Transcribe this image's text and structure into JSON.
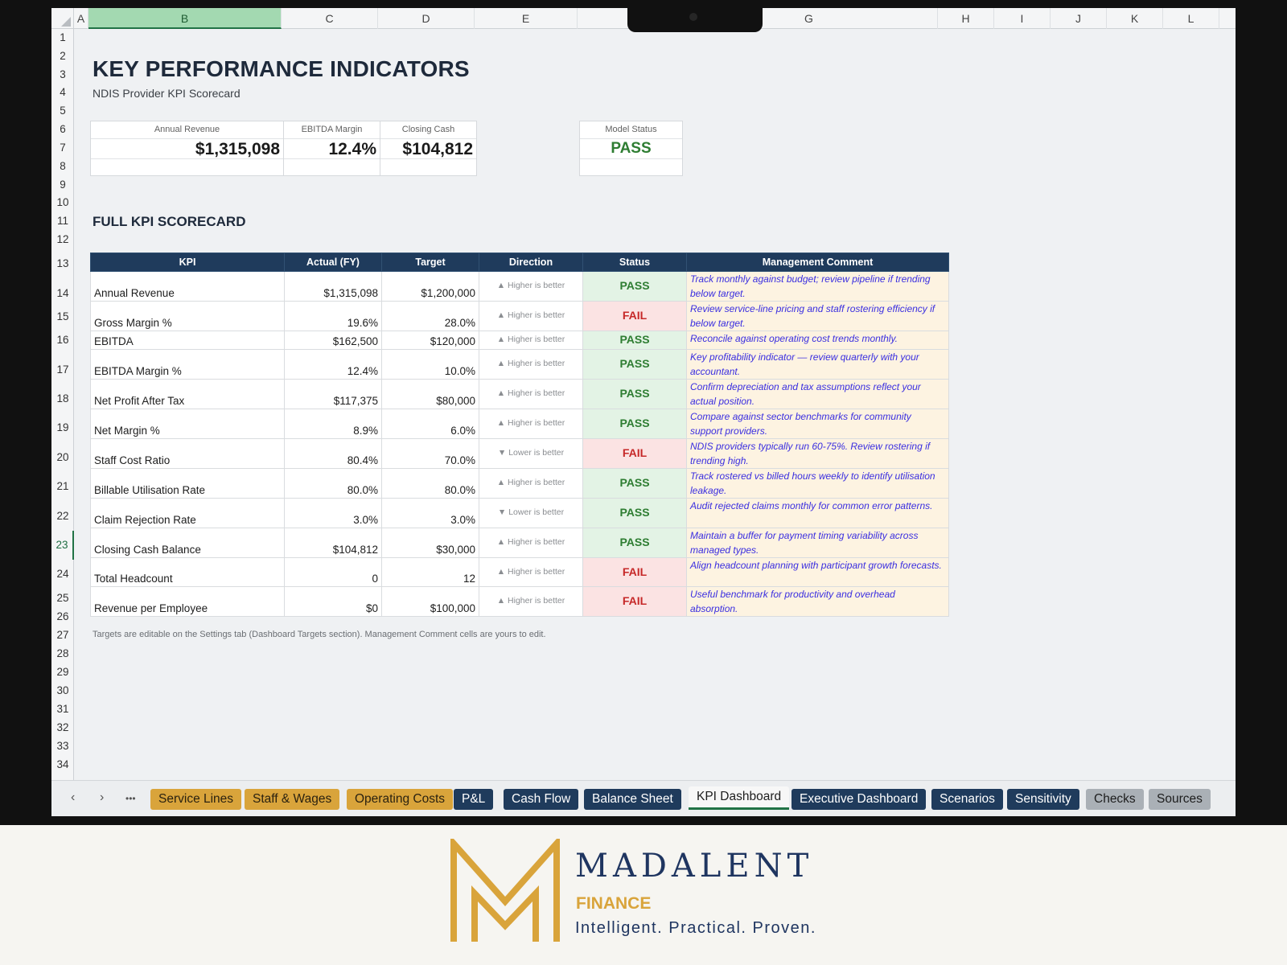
{
  "columns": [
    "A",
    "B",
    "C",
    "D",
    "E",
    "G",
    "H",
    "I",
    "J",
    "K",
    "L"
  ],
  "selected_column": "B",
  "rows": [
    "1",
    "2",
    "3",
    "4",
    "5",
    "6",
    "7",
    "8",
    "9",
    "10",
    "11",
    "12",
    "13",
    "14",
    "15",
    "16",
    "17",
    "18",
    "19",
    "20",
    "21",
    "22",
    "23",
    "24",
    "25",
    "26",
    "27",
    "28",
    "29",
    "30",
    "31",
    "32",
    "33",
    "34"
  ],
  "selected_row": "23",
  "page": {
    "title": "KEY PERFORMANCE INDICATORS",
    "subtitle": "NDIS Provider KPI Scorecard",
    "section": "FULL KPI SCORECARD",
    "footnote": "Targets are editable on the Settings tab (Dashboard Targets section). Management Comment cells are yours to edit."
  },
  "cards": {
    "revenue": {
      "label": "Annual Revenue",
      "value": "$1,315,098"
    },
    "ebitda": {
      "label": "EBITDA Margin",
      "value": "12.4%"
    },
    "cash": {
      "label": "Closing Cash",
      "value": "$104,812"
    },
    "status": {
      "label": "Model Status",
      "value": "PASS"
    }
  },
  "table": {
    "headers": [
      "KPI",
      "Actual (FY)",
      "Target",
      "Direction",
      "Status",
      "Management Comment"
    ],
    "rows": [
      {
        "kpi": "Annual Revenue",
        "actual": "$1,315,098",
        "target": "$1,200,000",
        "direction": "▲ Higher is better",
        "status": "PASS",
        "comment": "Track monthly against budget; review pipeline if trending below target."
      },
      {
        "kpi": "Gross Margin %",
        "actual": "19.6%",
        "target": "28.0%",
        "direction": "▲ Higher is better",
        "status": "FAIL",
        "comment": "Review service-line pricing and staff rostering efficiency if below target."
      },
      {
        "kpi": "EBITDA",
        "actual": "$162,500",
        "target": "$120,000",
        "direction": "▲ Higher is better",
        "status": "PASS",
        "comment": "Reconcile against operating cost trends monthly."
      },
      {
        "kpi": "EBITDA Margin %",
        "actual": "12.4%",
        "target": "10.0%",
        "direction": "▲ Higher is better",
        "status": "PASS",
        "comment": "Key profitability indicator — review quarterly with your accountant."
      },
      {
        "kpi": "Net Profit After Tax",
        "actual": "$117,375",
        "target": "$80,000",
        "direction": "▲ Higher is better",
        "status": "PASS",
        "comment": "Confirm depreciation and tax assumptions reflect your actual position."
      },
      {
        "kpi": "Net Margin %",
        "actual": "8.9%",
        "target": "6.0%",
        "direction": "▲ Higher is better",
        "status": "PASS",
        "comment": "Compare against sector benchmarks for community support providers."
      },
      {
        "kpi": "Staff Cost Ratio",
        "actual": "80.4%",
        "target": "70.0%",
        "direction": "▼ Lower is better",
        "status": "FAIL",
        "comment": "NDIS providers typically run 60-75%. Review rostering if trending high."
      },
      {
        "kpi": "Billable Utilisation Rate",
        "actual": "80.0%",
        "target": "80.0%",
        "direction": "▲ Higher is better",
        "status": "PASS",
        "comment": "Track rostered vs billed hours weekly to identify utilisation leakage."
      },
      {
        "kpi": "Claim Rejection Rate",
        "actual": "3.0%",
        "target": "3.0%",
        "direction": "▼ Lower is better",
        "status": "PASS",
        "comment": "Audit rejected claims monthly for common error patterns."
      },
      {
        "kpi": "Closing Cash Balance",
        "actual": "$104,812",
        "target": "$30,000",
        "direction": "▲ Higher is better",
        "status": "PASS",
        "comment": "Maintain a buffer for payment timing variability across managed types."
      },
      {
        "kpi": "Total Headcount",
        "actual": "0",
        "target": "12",
        "direction": "▲ Higher is better",
        "status": "FAIL",
        "comment": "Align headcount planning with participant growth forecasts."
      },
      {
        "kpi": "Revenue per Employee",
        "actual": "$0",
        "target": "$100,000",
        "direction": "▲ Higher is better",
        "status": "FAIL",
        "comment": "Useful benchmark for productivity and overhead absorption."
      }
    ]
  },
  "nav": {
    "prev": "‹",
    "next": "›",
    "more": "•••"
  },
  "tabs": [
    {
      "label": "Service Lines",
      "style": "gold"
    },
    {
      "label": "Staff & Wages",
      "style": "gold"
    },
    {
      "label": "Operating Costs",
      "style": "gold"
    },
    {
      "label": "P&L",
      "style": "navy"
    },
    {
      "label": "Cash Flow",
      "style": "navy"
    },
    {
      "label": "Balance Sheet",
      "style": "navy"
    },
    {
      "label": "KPI Dashboard",
      "style": "active"
    },
    {
      "label": "Executive Dashboard",
      "style": "navy"
    },
    {
      "label": "Scenarios",
      "style": "navy"
    },
    {
      "label": "Sensitivity",
      "style": "navy"
    },
    {
      "label": "Checks",
      "style": "grey"
    },
    {
      "label": "Sources",
      "style": "grey"
    }
  ],
  "brand": {
    "name": "MADALENT",
    "sub": "FINANCE",
    "tagline": "Intelligent. Practical. Proven.",
    "gold": "#d9a43b",
    "navy": "#1f3560"
  },
  "colors": {
    "pass": "#2e7d32",
    "fail": "#c62828",
    "header": "#1f3b5c",
    "comment": "#3a2ee0"
  }
}
